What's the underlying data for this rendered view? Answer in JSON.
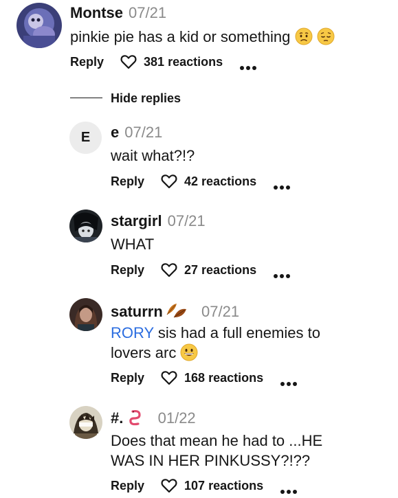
{
  "reply_label": "Reply",
  "hide_replies": "Hide replies",
  "comments": [
    {
      "author": "Montse",
      "date": "07/21",
      "text": "pinkie pie has a kid or something",
      "reactions": "381 reactions",
      "emojis": [
        "worried-face",
        "pensive-face"
      ]
    },
    {
      "author": "e",
      "avatar_letter": "E",
      "date": "07/21",
      "text": "wait what?!?",
      "reactions": "42 reactions"
    },
    {
      "author": "stargirl",
      "date": "07/21",
      "text": "WHAT",
      "reactions": "27 reactions"
    },
    {
      "author": "saturrn",
      "author_emoji": "fallen-leaf",
      "date": "07/21",
      "mention": "RORY",
      "text": "sis had a full enemies to lovers arc",
      "text_line1": "sis had a full enemies to",
      "text_line2": "lovers arc",
      "reactions": "168 reactions",
      "emojis": [
        "grinning-face"
      ]
    },
    {
      "author": "#.",
      "author_emoji": "worm",
      "date": "01/22",
      "text": "Does that mean he had to ...HE WAS IN HER PINKUSSY?!??",
      "text_line1": "Does that mean he had to ...HE",
      "text_line2": "WAS IN HER PINKUSSY?!??",
      "reactions": "107 reactions"
    }
  ]
}
